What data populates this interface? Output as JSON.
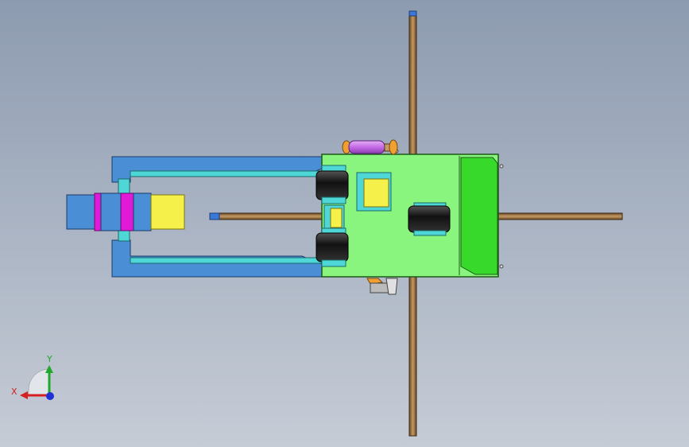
{
  "viewport": {
    "name": "cad-graphics-area",
    "background_top": "#8d9bb0",
    "background_bottom": "#c6ccd6"
  },
  "model": {
    "body_color": "#8af57e",
    "frame_color": "#4a8fd6",
    "rail_color": "#4fd6d6",
    "rod_color": "#b58a57",
    "accent_magenta": "#e01ad7",
    "accent_yellow": "#f5f04a",
    "cylinder_color": "#c46ae6",
    "wheel_color": "#222222"
  },
  "triad": {
    "x_label": "X",
    "y_label": "Y",
    "x_color": "#d42020",
    "y_color": "#1fa82a",
    "z_color": "#2030d6"
  }
}
